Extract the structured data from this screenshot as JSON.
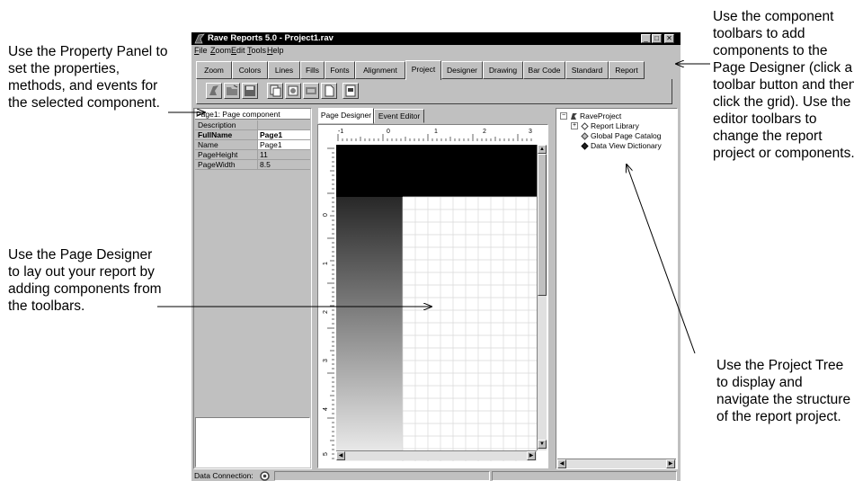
{
  "app": {
    "title": "Rave Reports 5.0 - Project1.rav",
    "window_buttons": {
      "minimize": "_",
      "maximize": "□",
      "close": "✕"
    }
  },
  "menu": [
    "File",
    "Zoom",
    "Edit",
    "Tools",
    "Help"
  ],
  "toolbar_tabs": [
    "Zoom",
    "Colors",
    "Lines",
    "Fills",
    "Fonts",
    "Alignment",
    "Project",
    "Designer",
    "Drawing",
    "Bar Code",
    "Standard",
    "Report"
  ],
  "active_toolbar_tab": "Project",
  "property_panel": {
    "title": "Page1: Page component",
    "rows": [
      {
        "name": "Description",
        "value": ""
      },
      {
        "name": "FullName",
        "value": "Page1"
      },
      {
        "name": "Name",
        "value": "Page1"
      },
      {
        "name": "PageHeight",
        "value": "11"
      },
      {
        "name": "PageWidth",
        "value": "8.5"
      }
    ]
  },
  "designer": {
    "tabs": [
      "Page Designer",
      "Event Editor"
    ],
    "active_tab": "Page Designer",
    "ruler_top": [
      "-1",
      "0",
      "1",
      "2",
      "3"
    ],
    "ruler_left": [
      "0",
      "1",
      "2",
      "3",
      "4",
      "5"
    ]
  },
  "project_tree": {
    "root": "RaveProject",
    "children": [
      "Report Library",
      "Global Page Catalog",
      "Data View Dictionary"
    ]
  },
  "status_bar": {
    "label": "Data Connection:"
  },
  "callouts": {
    "property_panel": "Use the Property Panel to set the properties, methods, and events for the selected component.",
    "page_designer": "Use the Page Designer to lay out your report by adding components from the toolbars.",
    "toolbars": "Use the component toolbars to add components to the Page Designer (click a toolbar button and then click the grid). Use the editor toolbars to change the report project or components.",
    "project_tree": "Use the Project Tree to display and navigate the structure of the report project."
  }
}
